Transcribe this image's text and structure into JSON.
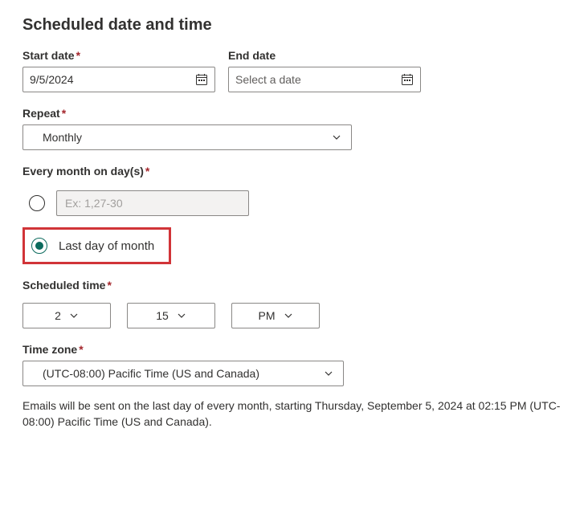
{
  "heading": "Scheduled date and time",
  "start_date": {
    "label": "Start date",
    "value": "9/5/2024",
    "required": true
  },
  "end_date": {
    "label": "End date",
    "placeholder": "Select a date",
    "required": false
  },
  "repeat": {
    "label": "Repeat",
    "value": "Monthly",
    "required": true
  },
  "every_month": {
    "label": "Every month on day(s)",
    "required": true,
    "days_placeholder": "Ex: 1,27-30",
    "last_day_label": "Last day of month"
  },
  "scheduled_time": {
    "label": "Scheduled time",
    "required": true,
    "hour": "2",
    "minute": "15",
    "ampm": "PM"
  },
  "time_zone": {
    "label": "Time zone",
    "required": true,
    "value": "(UTC-08:00) Pacific Time (US and Canada)"
  },
  "summary": "Emails will be sent on the last day of every month, starting Thursday, September 5, 2024 at 02:15 PM (UTC-08:00) Pacific Time (US and Canada)."
}
